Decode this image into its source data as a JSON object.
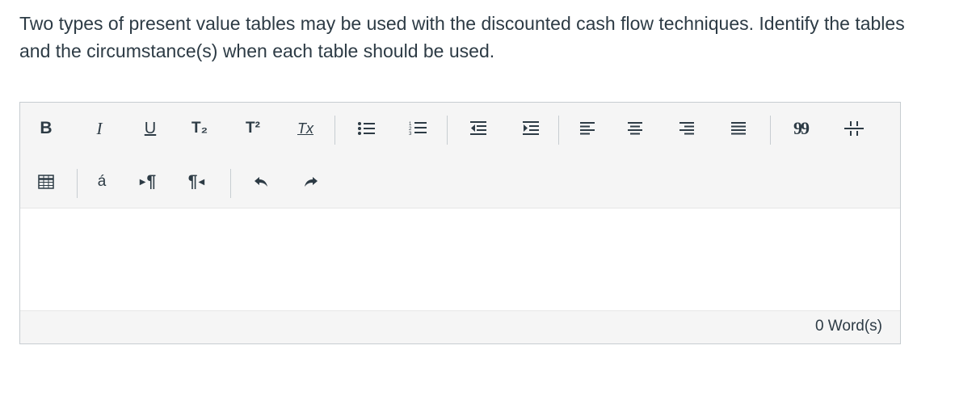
{
  "question": {
    "text": "Two types of present value tables may be used with the discounted cash flow techniques. Identify the tables and the circumstance(s) when each table should be used."
  },
  "toolbar": {
    "row1": [
      {
        "name": "bold-icon",
        "label": "B"
      },
      {
        "name": "italic-icon",
        "label": "I"
      },
      {
        "name": "underline-icon",
        "label": "U"
      },
      {
        "name": "subscript-icon",
        "label": "T₂"
      },
      {
        "name": "superscript-icon",
        "label": "T²"
      },
      {
        "name": "remove-format-icon",
        "label": "Tx"
      },
      {
        "name": "bullet-list-icon"
      },
      {
        "name": "numbered-list-icon"
      },
      {
        "name": "outdent-icon"
      },
      {
        "name": "indent-icon"
      },
      {
        "name": "align-left-icon"
      },
      {
        "name": "align-center-icon"
      },
      {
        "name": "align-right-icon"
      },
      {
        "name": "align-justify-icon"
      },
      {
        "name": "blockquote-icon",
        "label": "99"
      },
      {
        "name": "horizontal-rule-icon"
      }
    ],
    "row2": [
      {
        "name": "table-icon"
      },
      {
        "name": "special-character-icon",
        "label": "á"
      },
      {
        "name": "ltr-paragraph-icon",
        "label": "¶"
      },
      {
        "name": "rtl-paragraph-icon",
        "label": "¶"
      },
      {
        "name": "undo-icon"
      },
      {
        "name": "redo-icon"
      }
    ]
  },
  "editor": {
    "content": ""
  },
  "status": {
    "word_count": "0 Word(s)"
  },
  "colors": {
    "text": "#2d3b45",
    "toolbar_bg": "#f5f5f5",
    "border": "#c7cdd1"
  }
}
